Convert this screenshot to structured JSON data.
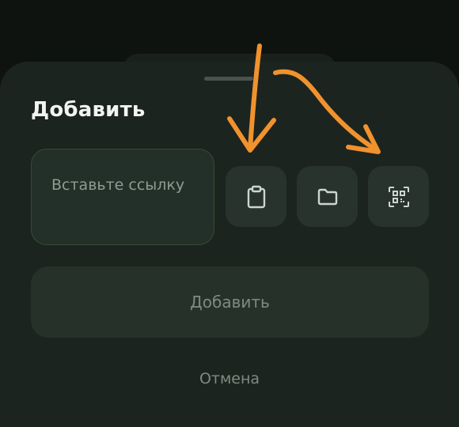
{
  "sheet": {
    "title": "Добавить",
    "link_input": {
      "placeholder": "Вставьте ссылку",
      "value": ""
    },
    "actions": [
      {
        "icon": "clipboard-icon"
      },
      {
        "icon": "folder-icon"
      },
      {
        "icon": "qr-code-icon"
      }
    ],
    "add_button_label": "Добавить",
    "cancel_label": "Отмена"
  },
  "colors": {
    "background": "#0f1310",
    "sheet": "#1c241f",
    "input_background": "#223029",
    "input_border": "#3a4a33",
    "icon_button": "#28332d",
    "primary_button": "#263229",
    "muted_text": "#7f8b82",
    "title_text": "#f2f4f1",
    "annotation_arrow": "#f0922e"
  }
}
